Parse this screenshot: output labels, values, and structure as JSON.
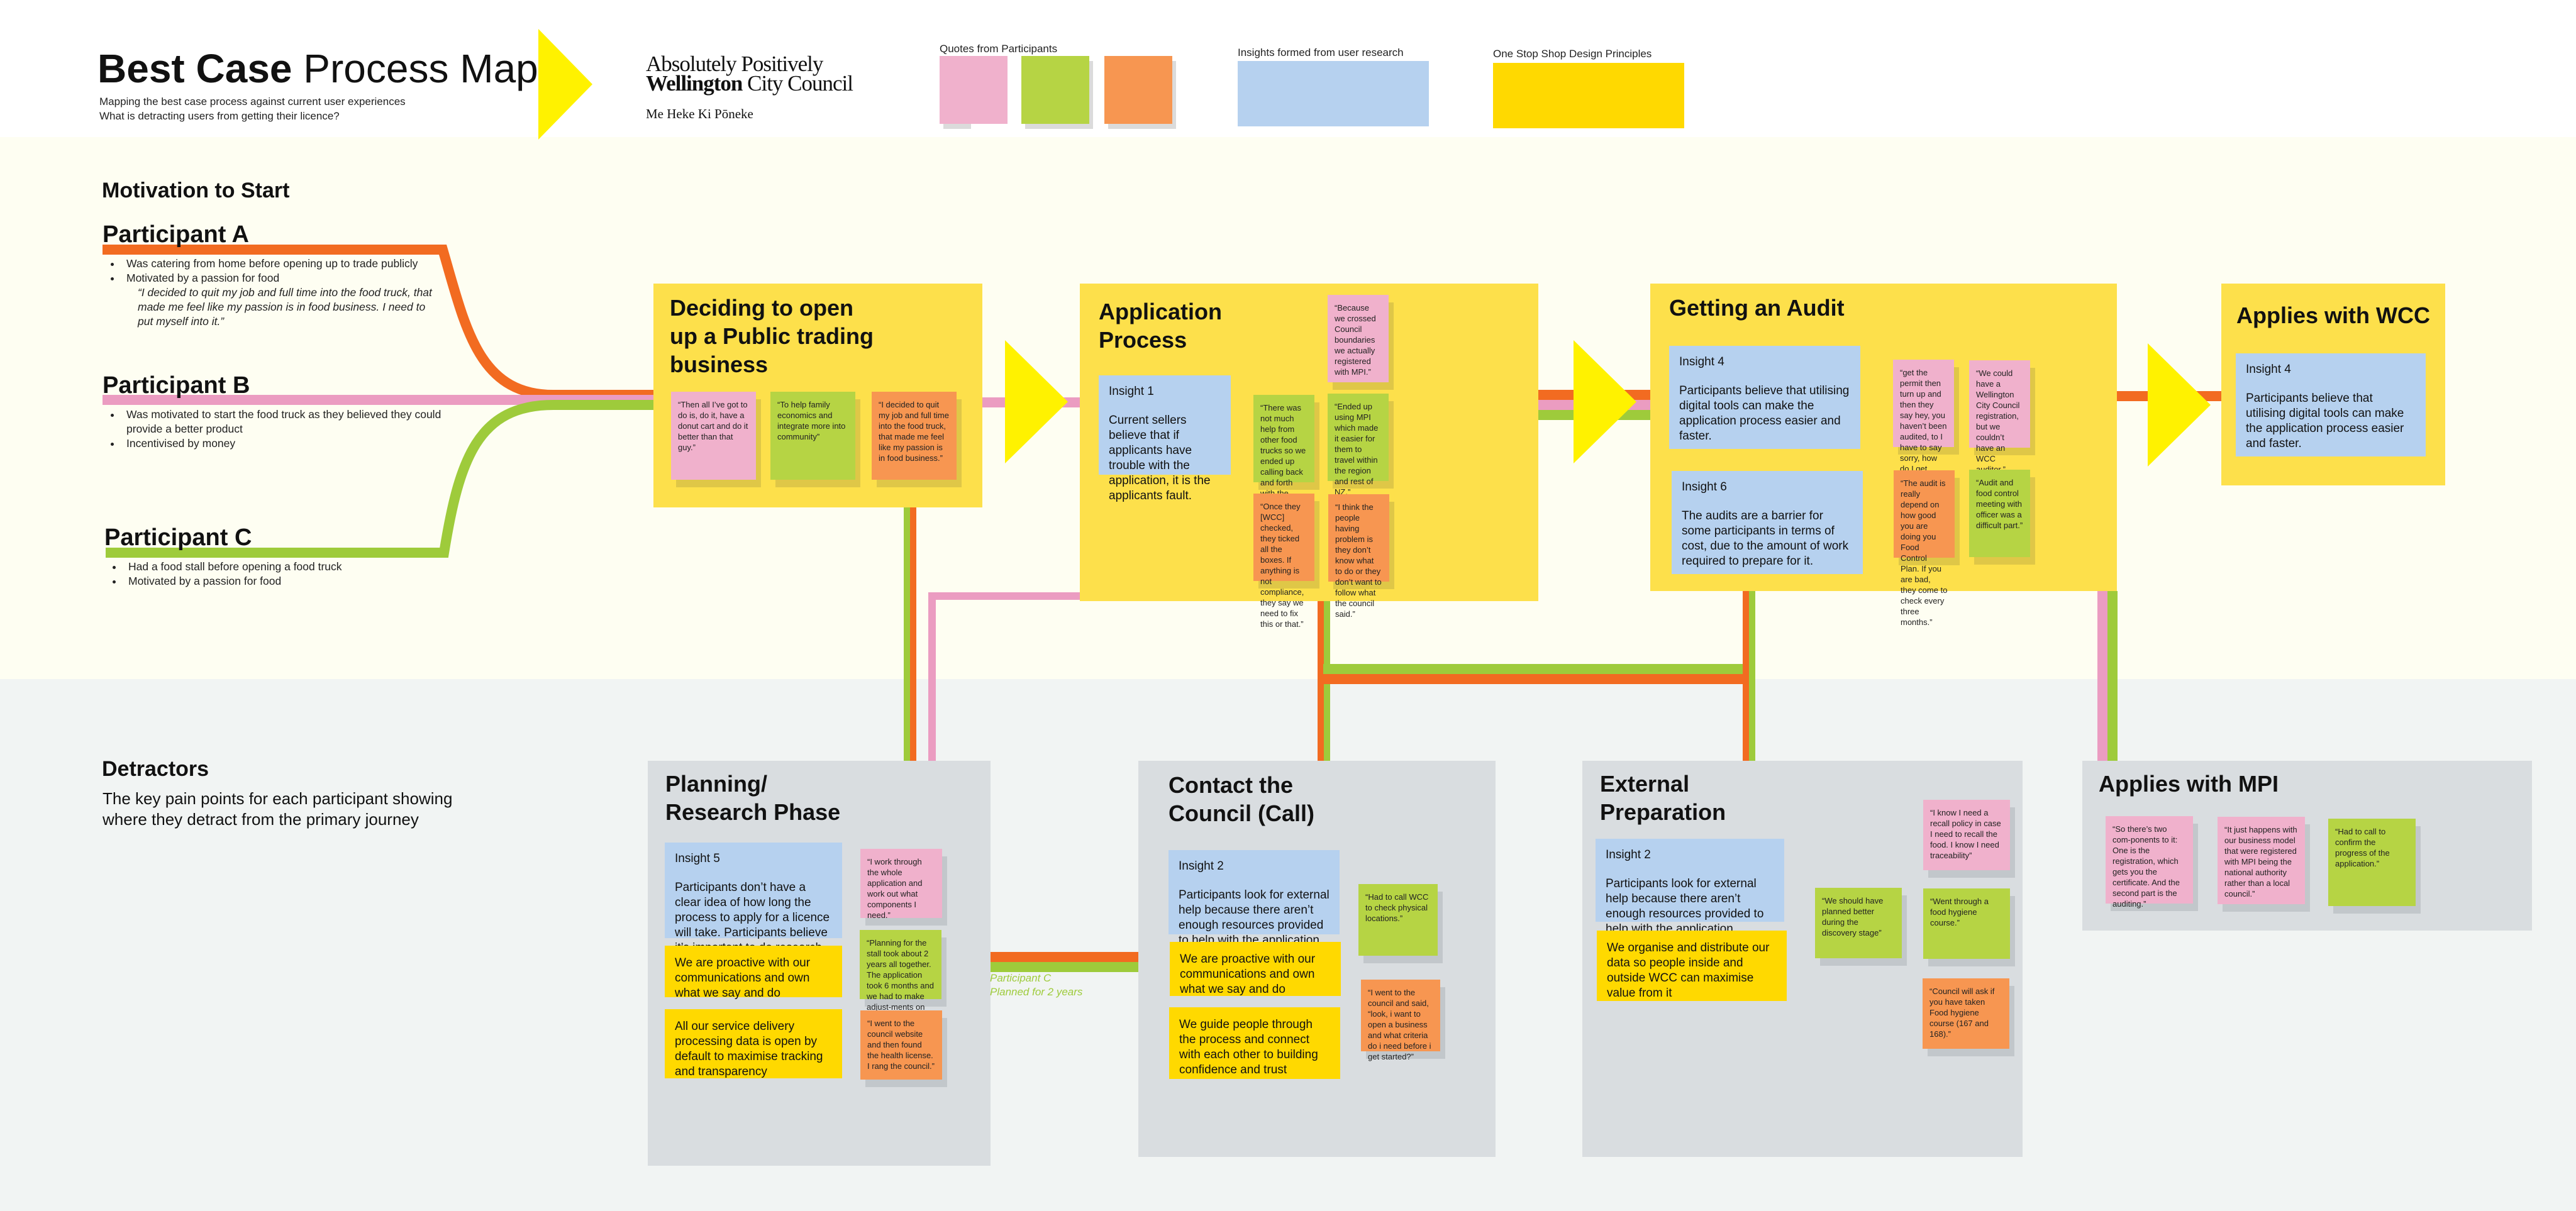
{
  "header": {
    "title_bold": "Best Case",
    "title_rest": " Process Map",
    "subtitle_line1": "Mapping the best case process against current user experiences",
    "subtitle_line2": "What is detracting users from getting their licence?",
    "logo": {
      "line1": "Absolutely Positively",
      "line2_bold": "Wellington",
      "line2_rest": " City Council",
      "line3": "Me Heke Ki Pōneke"
    }
  },
  "legend": {
    "quotes_label": "Quotes from Participants",
    "insights_label": "Insights formed from user research",
    "principles_label": "One Stop Shop Design Principles"
  },
  "colors": {
    "participant_a": "#f26b21",
    "participant_b": "#eb9cc1",
    "participant_c": "#9ecb3b",
    "stage_bg": "#fde04b",
    "detractor_bg": "#d9dde0",
    "insight": "#b6d1ef",
    "principle": "#ffd900",
    "quote_pink": "#f0b1cc",
    "quote_green": "#b6d444",
    "quote_orange": "#f79651",
    "arrow": "#fff200"
  },
  "motivation": {
    "heading": "Motivation to Start",
    "participants": [
      {
        "name": "Participant A",
        "bullets": [
          "Was catering from home before opening up to trade publicly",
          "Motivated by a passion for food"
        ],
        "quote": "“I decided to quit my job and full time into the food truck, that made me feel like my passion is in food business. I need to put myself into it.”"
      },
      {
        "name": "Participant B",
        "bullets": [
          "Was motivated to start the food truck as they believed they could provide a better product",
          "Incentivised by money"
        ]
      },
      {
        "name": "Participant C",
        "bullets": [
          "Had a food stall before opening a food truck",
          "Motivated by a passion for food"
        ]
      }
    ]
  },
  "stages": {
    "deciding": {
      "title": "Deciding to open up a Public trading business",
      "quotes": [
        "“Then all I’ve got to do is, do it, have a donut cart and do it better than that guy.”",
        "“To help family economics and integrate more into community”",
        "“I decided to quit my job and full time into the food truck, that made me feel like my passion is in food business.”"
      ]
    },
    "application": {
      "title": "Application Process",
      "insight_label": "Insight 1",
      "insight_text": "Current sellers believe that if applicants have trouble with the application, it is the applicants fault.",
      "quotes": [
        "“Because we crossed Council boundaries we actually registered with MPI.”",
        "“There was not much help from other food trucks so we ended up calling back and forth with the council.”",
        "“Ended up using MPI which made it easier for them to travel within the region and rest of NZ.”",
        "“Once they [WCC] checked, they ticked all the boxes. If anything is not compliance, they say we need to fix this or that.”",
        "“I think the people having problem is they don’t know what to do or they don’t want to follow what the council said.”"
      ]
    },
    "audit": {
      "title": "Getting an Audit",
      "insights": [
        {
          "label": "Insight 4",
          "text": "Participants believe that utilising digital tools can make the application process easier and faster."
        },
        {
          "label": "Insight 6",
          "text": "The audits are a barrier for some participants in terms of cost, due to the amount of work required to prepare for it."
        }
      ],
      "quotes": [
        "“get the permit then turn up and then they say hey, you haven’t been audited, to I have to say sorry, how do I get audited?”",
        "“We could have a Wellington City Council registration, but we couldn’t have an WCC auditor.”",
        "“The audit is really depend on how good you are doing you Food Control Plan. If you are bad, they come to check every three months.”",
        "“Audit and food control meeting with officer was a difficult part.”"
      ]
    },
    "wcc": {
      "title": "Applies with WCC",
      "insight_label": "Insight 4",
      "insight_text": "Participants believe that utilising digital tools can make the application process easier and faster."
    }
  },
  "detractors": {
    "heading": "Detractors",
    "subheading": "The key pain points for each participant showing where they detract from the primary journey",
    "planning": {
      "title": "Planning/ Research Phase",
      "insight_label": "Insight 5",
      "insight_text": "Participants don’t have a clear idea of how long the process to apply for a licence will take. Participants believe it’s important to do research and plan ahead.",
      "principles": [
        "We are proactive with our communications and own what we say and do",
        "All our service delivery processing data is open by default to maximise tracking and transparency"
      ],
      "quotes": [
        "“I work through the whole application and work out what components I need.”",
        "“Planning for the stall took about 2 years all together. The application took 6 months and we had to make adjust-ments on the truck.”",
        "“I went to the council website and then found the health license. I rang the council.”"
      ],
      "side_note_line1": "Participant C",
      "side_note_line2": "Planned for 2 years"
    },
    "contact": {
      "title": "Contact the Council (Call)",
      "insight_label": "Insight 2",
      "insight_text": "Participants look for external help because there aren’t enough resources provided to help with the application process.",
      "principles": [
        "We are proactive with our communications and own what we say and do",
        "We guide people through the process and connect with each other to building confidence and trust"
      ],
      "quotes": [
        "“Had to call WCC to check physical locations.”",
        "“I went to the council and said, “look, i want to open a business and what criteria do i need before i get started?”"
      ]
    },
    "external": {
      "title": "External Preparation",
      "insight_label": "Insight 2",
      "insight_text": "Participants look for external help because there aren’t enough resources provided to help with the application process.",
      "principles": [
        "We organise and distribute our data so people inside and outside WCC can maximise value from it"
      ],
      "quotes": [
        "“I know I need a recall policy in case I need to recall the food. I know I need traceability”",
        "“We should have planned better during the discovery stage”",
        "“Went through a food hygiene course.”",
        "“Council will ask if you have taken Food hygiene course (167 and 168).”"
      ]
    },
    "mpi": {
      "title": "Applies with MPI",
      "quotes": [
        "“So there’s two com-ponents to it: One is the registration, which gets you the certificate. And the second part is the auditing.”",
        "“It just happens with our business model that were registered with MPI being the national authority rather than a local council.”",
        "“Had to call to confirm the progress of the application.”"
      ]
    }
  }
}
